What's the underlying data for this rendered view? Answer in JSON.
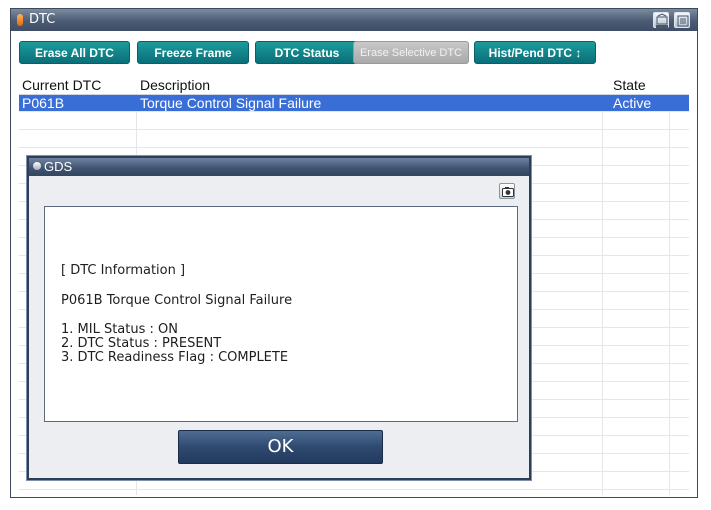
{
  "window": {
    "title": "DTC"
  },
  "toolbar": {
    "erase_all": "Erase All DTC",
    "freeze_frame": "Freeze Frame",
    "dtc_status": "DTC Status",
    "erase_selective": "Erase Selective DTC",
    "hist_pend": "Hist/Pend DTC ↕"
  },
  "grid": {
    "columns": [
      "Current DTC",
      "Description",
      "State"
    ],
    "rows": [
      {
        "code": "P061B",
        "description": "Torque Control Signal Failure",
        "state": "Active"
      }
    ]
  },
  "dialog": {
    "title": "GDS",
    "lines": [
      "[ DTC Information ]",
      "P061B Torque Control Signal Failure",
      "1. MIL Status : ON",
      "2. DTC Status : PRESENT",
      "3. DTC Readiness Flag : COMPLETE"
    ],
    "ok_label": "OK"
  },
  "icons": {
    "title_indicator": "orange-status-indicator",
    "retry": "retry-icon",
    "menu": "menu-icon",
    "camera": "camera-icon"
  }
}
